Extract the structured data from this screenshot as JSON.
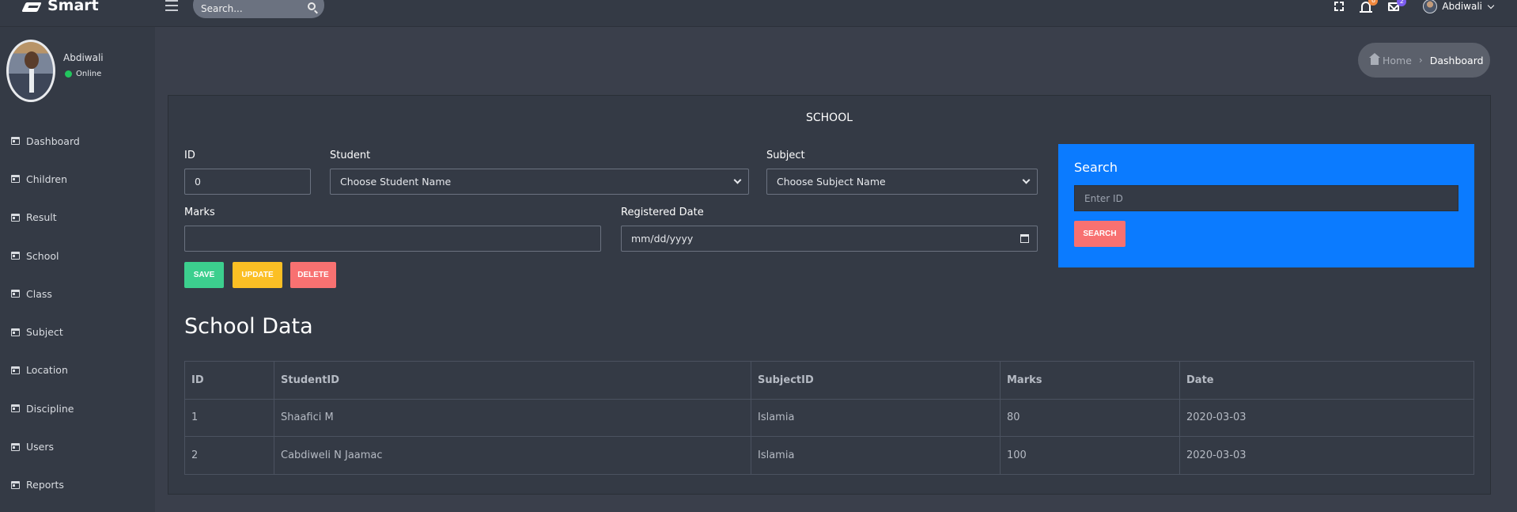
{
  "app": {
    "name": "Smart"
  },
  "topbar": {
    "search_placeholder": "Search...",
    "notifications_count": "6",
    "messages_count": "2",
    "user_name": "Abdiwali"
  },
  "sidebar": {
    "profile": {
      "name": "Abdiwali",
      "status": "Online"
    },
    "items": [
      {
        "label": "Dashboard"
      },
      {
        "label": "Children"
      },
      {
        "label": "Result"
      },
      {
        "label": "School"
      },
      {
        "label": "Class"
      },
      {
        "label": "Subject"
      },
      {
        "label": "Location"
      },
      {
        "label": "Discipline"
      },
      {
        "label": "Users"
      },
      {
        "label": "Reports"
      }
    ]
  },
  "breadcrumb": {
    "home": "Home",
    "current": "Dashboard"
  },
  "form": {
    "title": "SCHOOL",
    "id_label": "ID",
    "id_value": "0",
    "student_label": "Student",
    "student_value": "Choose Student Name",
    "subject_label": "Subject",
    "subject_value": "Choose Subject Name",
    "marks_label": "Marks",
    "marks_value": "",
    "date_label": "Registered Date",
    "date_value": "mm/dd/yyyy",
    "save": "SAVE",
    "update": "UPDATE",
    "delete": "DELETE"
  },
  "search_panel": {
    "title": "Search",
    "placeholder": "Enter ID",
    "button": "SEARCH"
  },
  "table": {
    "title": "School Data",
    "headers": [
      "ID",
      "StudentID",
      "SubjectID",
      "Marks",
      "Date"
    ],
    "rows": [
      [
        "1",
        "Shaafici M",
        "Islamia",
        "80",
        "2020-03-03"
      ],
      [
        "2",
        "Cabdiweli N Jaamac",
        "Islamia",
        "100",
        "2020-03-03"
      ]
    ]
  },
  "colors": {
    "accent_blue": "#0b7bff",
    "save_green": "#3ccf8e",
    "update_yellow": "#fbbf24",
    "delete_red": "#f87171"
  }
}
